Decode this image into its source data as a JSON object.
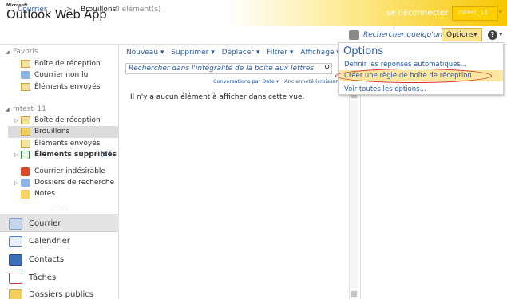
{
  "header": {
    "brand_small": "Microsoft",
    "app_title": "Outlook Web App",
    "logout_label": "se déconnecter",
    "user_name": "mtest_11"
  },
  "breadcrumb": {
    "root": "Courrier",
    "separator": ">",
    "current": "Brouillons",
    "count": "0 élément(s)"
  },
  "topbar": {
    "find_someone": "Rechercher quelqu'un",
    "options_label": "Options",
    "help_label": "?"
  },
  "sidebar": {
    "favorites_title": "Favoris",
    "favorites": [
      "Boîte de réception",
      "Courrier non lu",
      "Éléments envoyés"
    ],
    "mailbox_title": "mtest_11",
    "folders": [
      "Boîte de réception",
      "Brouillons",
      "Éléments envoyés",
      "Éléments supprimés",
      "Courrier indésirable",
      "Dossiers de recherche",
      "Notes"
    ],
    "deleted_count": "(2)",
    "dots": "....."
  },
  "nav": {
    "items": [
      "Courrier",
      "Calendrier",
      "Contacts",
      "Tâches",
      "Dossiers publics"
    ]
  },
  "toolbar": {
    "items": [
      "Nouveau ▾",
      "Supprimer ▾",
      "Déplacer ▾",
      "Filtrer ▾",
      "Affichage ▾"
    ]
  },
  "search": {
    "placeholder": "Rechercher dans l'intégralité de la boîte aux lettres"
  },
  "list": {
    "conversations": "Conversations par Date ▾",
    "sort": "Ancienneté (croissant)",
    "empty_message": "Il n'y a aucun élément à afficher dans cette vue."
  },
  "options_menu": {
    "title": "Options",
    "items": [
      "Définir les réponses automatiques...",
      "Créer une règle de boîte de réception...",
      "Voir toutes les options..."
    ]
  },
  "colors": {
    "link": "#2a5ba8",
    "header_accent": "#f7c600",
    "highlight": "#fde6a0",
    "annotation_red": "#d8332a"
  }
}
